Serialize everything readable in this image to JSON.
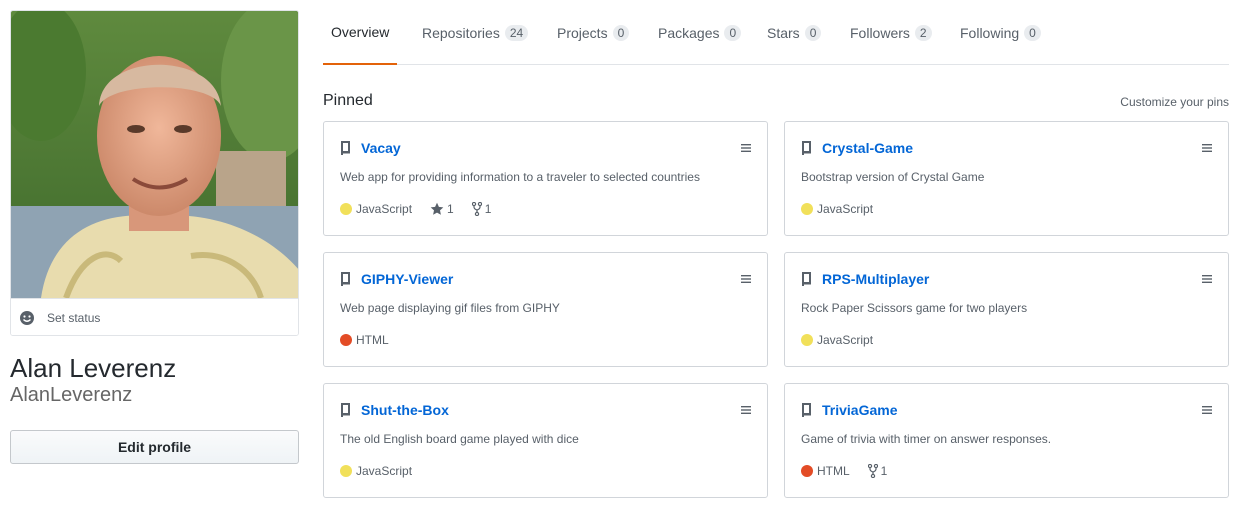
{
  "profile": {
    "fullname": "Alan Leverenz",
    "username": "AlanLeverenz",
    "set_status": "Set status",
    "edit_profile": "Edit profile"
  },
  "nav": {
    "tabs": [
      {
        "label": "Overview",
        "count": null
      },
      {
        "label": "Repositories",
        "count": "24"
      },
      {
        "label": "Projects",
        "count": "0"
      },
      {
        "label": "Packages",
        "count": "0"
      },
      {
        "label": "Stars",
        "count": "0"
      },
      {
        "label": "Followers",
        "count": "2"
      },
      {
        "label": "Following",
        "count": "0"
      }
    ]
  },
  "pinned": {
    "title": "Pinned",
    "customize": "Customize your pins",
    "repos": [
      {
        "name": "Vacay",
        "description": "Web app for providing information to a traveler to selected countries",
        "language": "JavaScript",
        "language_color": "#f1e05a",
        "stars": "1",
        "forks": "1"
      },
      {
        "name": "Crystal-Game",
        "description": "Bootstrap version of Crystal Game",
        "language": "JavaScript",
        "language_color": "#f1e05a"
      },
      {
        "name": "GIPHY-Viewer",
        "description": "Web page displaying gif files from GIPHY",
        "language": "HTML",
        "language_color": "#e34c26"
      },
      {
        "name": "RPS-Multiplayer",
        "description": "Rock Paper Scissors game for two players",
        "language": "JavaScript",
        "language_color": "#f1e05a"
      },
      {
        "name": "Shut-the-Box",
        "description": "The old English board game played with dice",
        "language": "JavaScript",
        "language_color": "#f1e05a"
      },
      {
        "name": "TriviaGame",
        "description": "Game of trivia with timer on answer responses.",
        "language": "HTML",
        "language_color": "#e34c26",
        "forks": "1"
      }
    ]
  },
  "colors": {
    "accent_tab": "#e36209",
    "link": "#0366d6"
  },
  "icons": {
    "repo": "repo-icon",
    "grabber": "grabber-icon",
    "star": "star-icon",
    "fork": "fork-icon",
    "smiley": "smiley-icon"
  }
}
